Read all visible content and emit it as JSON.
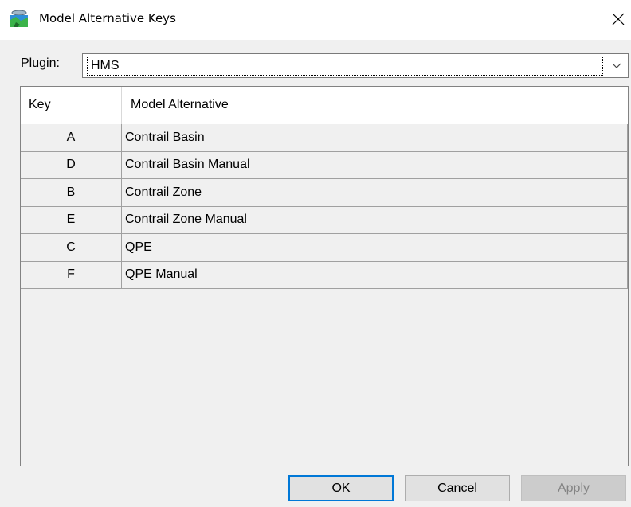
{
  "window": {
    "title": "Model Alternative Keys",
    "icon": "database-map-icon",
    "close_icon": "close-icon"
  },
  "plugin": {
    "label": "Plugin:",
    "selected": "HMS",
    "dropdown_icon": "chevron-down-icon"
  },
  "table": {
    "columns": [
      "Key",
      "Model Alternative"
    ],
    "rows": [
      {
        "key": "A",
        "model_alternative": "Contrail Basin"
      },
      {
        "key": "D",
        "model_alternative": "Contrail Basin Manual"
      },
      {
        "key": "B",
        "model_alternative": "Contrail Zone"
      },
      {
        "key": "E",
        "model_alternative": "Contrail Zone Manual"
      },
      {
        "key": "C",
        "model_alternative": "QPE"
      },
      {
        "key": "F",
        "model_alternative": "QPE Manual"
      }
    ]
  },
  "buttons": {
    "ok": "OK",
    "cancel": "Cancel",
    "apply": "Apply"
  },
  "colors": {
    "default_button_border": "#0078d7",
    "disabled_text": "#838383"
  }
}
